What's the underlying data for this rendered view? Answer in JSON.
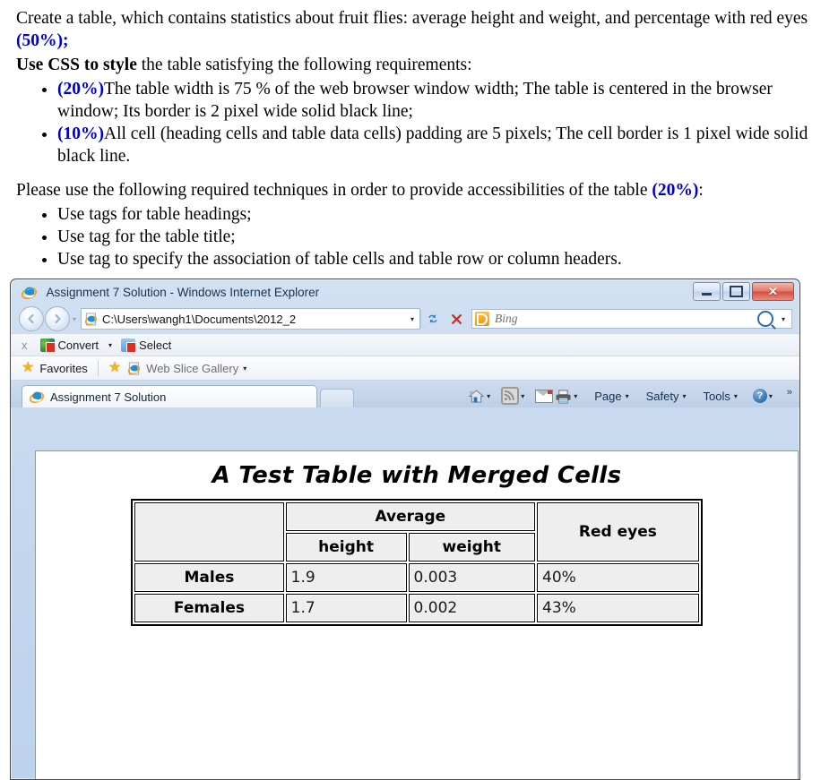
{
  "assignment": {
    "para1_a": "Create a table, which contains statistics about fruit flies: average height and weight, and percentage with red eyes ",
    "para1_mark": "(50%);",
    "para2_bold": "Use CSS to style",
    "para2_rest": " the table satisfying the following requirements:",
    "requirements": [
      {
        "mark": "(20%)",
        "text": "The table width is 75 % of the web browser window width; The table is centered in the browser window; Its border is 2 pixel wide solid black line;"
      },
      {
        "mark": "(10%)",
        "text": "All cell (heading cells and table data cells) padding are 5 pixels; The cell border is 1 pixel wide solid black line."
      }
    ],
    "para3_a": "Please use the following required techniques in order to provide accessibilities of the table ",
    "para3_mark": "(20%)",
    "para3_b": ":",
    "techniques": [
      "Use tags for table headings;",
      "Use tag for the table title;",
      "Use tag to specify the association of table cells and table row or column headers."
    ],
    "accent_color": "#0000cc"
  },
  "browser": {
    "window_title": "Assignment 7 Solution - Windows Internet Explorer",
    "window_controls": {
      "minimize": "Minimize",
      "maximize": "Maximize",
      "close": "Close"
    },
    "nav": {
      "back": "Back",
      "forward": "Forward",
      "history_caret": "▾",
      "address_value": "C:\\Users\\wangh1\\Documents\\2012_2",
      "address_caret": "▾",
      "refresh": "Refresh",
      "stop": "Stop",
      "search_placeholder": "Bing",
      "search_caret": "▾"
    },
    "command_bar": {
      "close_label": "x",
      "convert_label": "Convert",
      "convert_caret": "▾",
      "select_label": "Select"
    },
    "favorites_bar": {
      "favorites_label": "Favorites",
      "web_slice_label": "Web Slice Gallery",
      "web_slice_caret": "▾"
    },
    "tabs": [
      {
        "label": "Assignment 7 Solution"
      }
    ],
    "new_tab_label": "",
    "toolbar": {
      "home_caret": "▾",
      "feeds_caret": "▾",
      "print_caret": "▾",
      "page_label": "Page",
      "page_caret": "▾",
      "safety_label": "Safety",
      "safety_caret": "▾",
      "tools_label": "Tools",
      "tools_caret": "▾",
      "help_caret": "▾",
      "overflow": "»"
    }
  },
  "page": {
    "table_caption": "A Test Table with Merged Cells",
    "header_blank": "",
    "header_average": "Average",
    "header_height": "height",
    "header_weight": "weight",
    "header_red_eyes": "Red eyes",
    "rows": [
      {
        "label": "Males",
        "height": "1.9",
        "weight": "0.003",
        "red_eyes": "40%"
      },
      {
        "label": "Females",
        "height": "1.7",
        "weight": "0.002",
        "red_eyes": "43%"
      }
    ]
  }
}
